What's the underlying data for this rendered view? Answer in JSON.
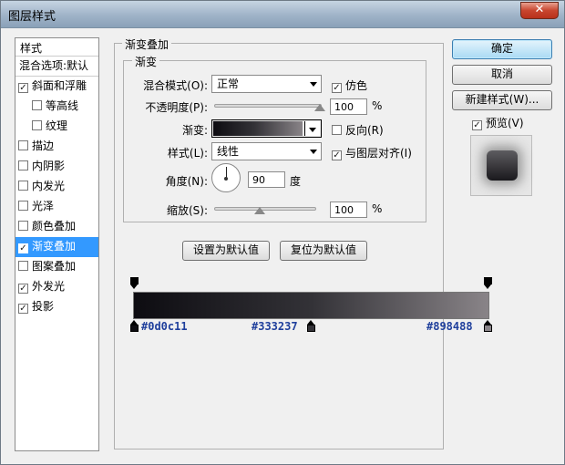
{
  "window": {
    "title": "图层样式",
    "close": "✕"
  },
  "sidebar": {
    "header": "样式",
    "blend_label": "混合选项:默认",
    "items": [
      {
        "label": "斜面和浮雕",
        "checked": "✓"
      },
      {
        "label": "等高线",
        "checked": ""
      },
      {
        "label": "纹理",
        "checked": ""
      },
      {
        "label": "描边",
        "checked": ""
      },
      {
        "label": "内阴影",
        "checked": ""
      },
      {
        "label": "内发光",
        "checked": ""
      },
      {
        "label": "光泽",
        "checked": ""
      },
      {
        "label": "颜色叠加",
        "checked": ""
      },
      {
        "label": "渐变叠加",
        "checked": "✓"
      },
      {
        "label": "图案叠加",
        "checked": ""
      },
      {
        "label": "外发光",
        "checked": "✓"
      },
      {
        "label": "投影",
        "checked": "✓"
      }
    ]
  },
  "panel": {
    "title": "渐变叠加",
    "sub_title": "渐变",
    "blend_mode_label": "混合模式(O):",
    "blend_mode_value": "正常",
    "dither_label": "仿色",
    "dither_checked": "✓",
    "opacity_label": "不透明度(P):",
    "opacity_value": "100",
    "opacity_percent": 100,
    "opacity_unit": "%",
    "gradient_label": "渐变:",
    "reverse_label": "反向(R)",
    "reverse_checked": "",
    "style_label": "样式(L):",
    "style_value": "线性",
    "align_label": "与图层对齐(I)",
    "align_checked": "✓",
    "angle_label": "角度(N):",
    "angle_value": "90",
    "angle_unit": "度",
    "scale_label": "缩放(S):",
    "scale_value": "100",
    "scale_percent": 100,
    "scale_unit": "%",
    "default_button": "设置为默认值",
    "reset_button": "复位为默认值"
  },
  "buttons": {
    "ok": "确定",
    "cancel": "取消",
    "new_style": "新建样式(W)...",
    "preview_label": "预览(V)",
    "preview_checked": "✓"
  },
  "gradient_editor": {
    "stops": [
      {
        "color": "#0d0c11",
        "label": "#0d0c11"
      },
      {
        "color": "#333237",
        "label": "#333237"
      },
      {
        "color": "#898488",
        "label": "#898488"
      }
    ]
  }
}
